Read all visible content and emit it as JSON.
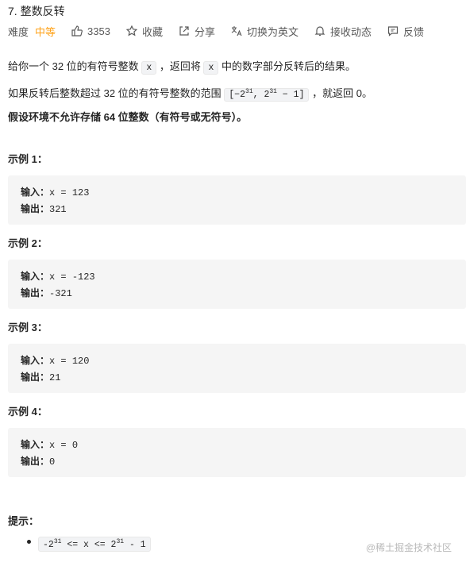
{
  "problem": {
    "title": "7. 整数反转",
    "difficulty_label": "难度",
    "difficulty": "中等",
    "likes": "3353",
    "favorite": "收藏",
    "share": "分享",
    "switch_lang": "切换为英文",
    "notify": "接收动态",
    "feedback": "反馈"
  },
  "description": {
    "p1_a": "给你一个 32 位的有符号整数",
    "p1_code": "x",
    "p1_b": "，返回将",
    "p1_code2": "x",
    "p1_c": "中的数字部分反转后的结果。",
    "p2_a": "如果反转后整数超过 32 位的有符号整数的范围",
    "p2_range_a": "[−2",
    "p2_exp1": "31",
    "p2_range_b": ",  2",
    "p2_exp2": "31",
    "p2_range_c": " − 1]",
    "p2_b": "，就返回 0。",
    "p3": "假设环境不允许存储 64 位整数（有符号或无符号）。"
  },
  "examples": [
    {
      "title": "示例 1：",
      "input_label": "输入：",
      "input": "x = 123",
      "output_label": "输出：",
      "output": "321"
    },
    {
      "title": "示例 2：",
      "input_label": "输入：",
      "input": "x = -123",
      "output_label": "输出：",
      "output": "-321"
    },
    {
      "title": "示例 3：",
      "input_label": "输入：",
      "input": "x = 120",
      "output_label": "输出：",
      "output": "21"
    },
    {
      "title": "示例 4：",
      "input_label": "输入：",
      "input": "x = 0",
      "output_label": "输出：",
      "output": "0"
    }
  ],
  "hints": {
    "title": "提示：",
    "c_a": "-2",
    "c_exp1": "31",
    "c_b": " <= x <= 2",
    "c_exp2": "31",
    "c_c": " - 1"
  },
  "watermark": "@稀土掘金技术社区",
  "colors": {
    "difficulty": "#ffa116",
    "code_bg": "#f2f3f5",
    "example_bg": "#f5f5f5"
  }
}
